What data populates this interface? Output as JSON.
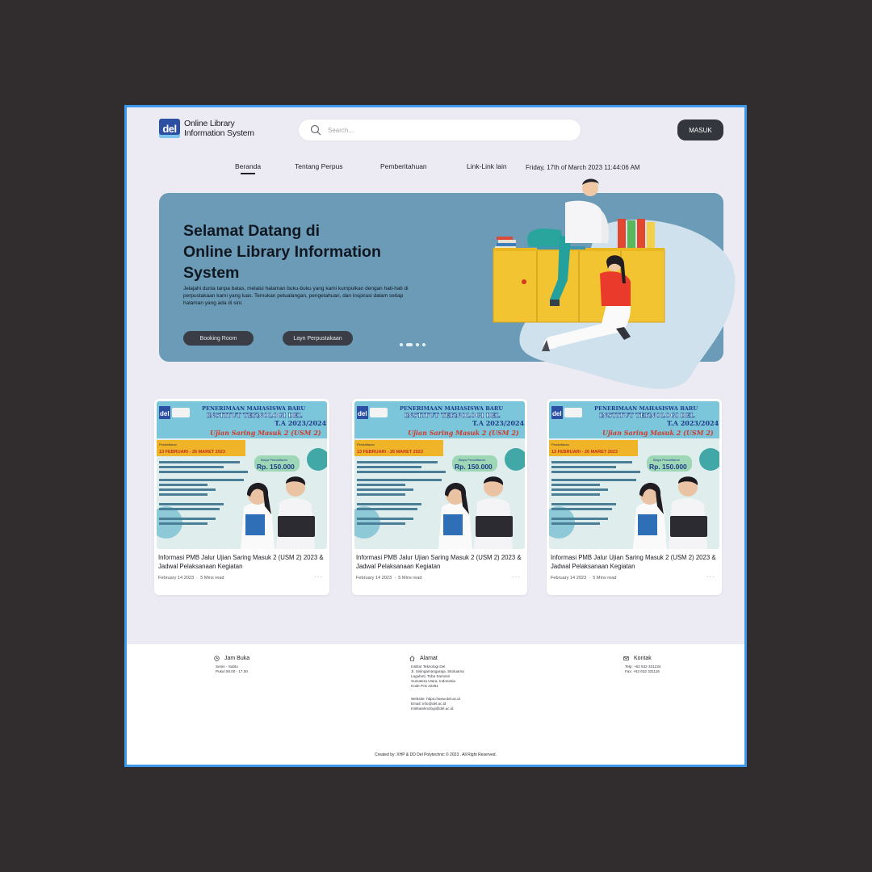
{
  "header": {
    "logo_badge": "del",
    "logo_line1": "Online Library",
    "logo_line2": "Information System",
    "search_placeholder": "Search...",
    "login_label": "MASUK"
  },
  "nav": {
    "items": [
      "Beranda",
      "Tentang Perpus",
      "Pemberitahuan",
      "Link-Link lain"
    ],
    "active": "Beranda",
    "datetime": "Friday, 17th of March 2023 11:44:06 AM"
  },
  "hero": {
    "title_line1": "Selamat Datang di",
    "title_line2": "Online Library Information",
    "title_line3": "System",
    "description": "Jelajahi dunia tanpa batas, melalui halaman buku-buku yang kami kumpulkan dengan hati-hati di perpustakaan kami yang luas. Temukan petualangan, pengetahuan, dan inspirasi dalam setiap halaman yang ada di sini.",
    "button1": "Booking Room",
    "button2": "Layn Perpustakaan"
  },
  "cards": [
    {
      "poster_header1": "PENERIMAAN MAHASISWA BARU",
      "poster_header2": "INSTITUT TEKNOLOGI DEL",
      "poster_year": "T.A 2023/2024",
      "poster_exam": "Ujian Saring Masuk 2 (USM 2)",
      "poster_dates_label": "Pendaftaran",
      "poster_dates": "13 FEBRUARI - 26 MARET 2023",
      "poster_fee_label": "Biaya Pendaftaran",
      "poster_fee": "Rp. 150.000",
      "title": "Informasi PMB Jalur Ujian Saring Masuk 2 (USM 2) 2023 & Jadwal Pelaksanaan Kegiatan",
      "date": "February 14 2023",
      "read": "5 Mins read"
    },
    {
      "poster_header1": "PENERIMAAN MAHASISWA BARU",
      "poster_header2": "INSTITUT TEKNOLOGI DEL",
      "poster_year": "T.A 2023/2024",
      "poster_exam": "Ujian Saring Masuk 2 (USM 2)",
      "poster_dates_label": "Pendaftaran",
      "poster_dates": "13 FEBRUARI - 26 MARET 2023",
      "poster_fee_label": "Biaya Pendaftaran",
      "poster_fee": "Rp. 150.000",
      "title": "Informasi PMB Jalur Ujian Saring Masuk 2 (USM 2) 2023 & Jadwal Pelaksanaan Kegiatan",
      "date": "February 14 2023",
      "read": "5 Mins read"
    },
    {
      "poster_header1": "PENERIMAAN MAHASISWA BARU",
      "poster_header2": "INSTITUT TEKNOLOGI DEL",
      "poster_year": "T.A 2023/2024",
      "poster_exam": "Ujian Saring Masuk 2 (USM 2)",
      "poster_dates_label": "Pendaftaran",
      "poster_dates": "13 FEBRUARI - 26 MARET 2023",
      "poster_fee_label": "Biaya Pendaftaran",
      "poster_fee": "Rp. 150.000",
      "title": "Informasi PMB Jalur Ujian Saring Masuk 2 (USM 2) 2023 & Jadwal Pelaksanaan Kegiatan",
      "date": "February 14 2023",
      "read": "5 Mins read"
    }
  ],
  "footer": {
    "hours_title": "Jam Buka",
    "hours_line1": "Senin - Sabtu",
    "hours_line2": "Pukul 08.00 - 17.00",
    "address_title": "Alamat",
    "address_line1": "Institut Teknologi Del",
    "address_line2": "Jl. Sisingamangaraja, Sitoluama",
    "address_line3": "Laguboti, Toba Samosir",
    "address_line4": "Sumatera Utara, Indonesia",
    "address_line5": "Kode Pos 22381",
    "address_line6": "Website: https://www.del.ac.id",
    "address_line7": "Email: info@del.ac.id",
    "address_line8": "Instituteknologi@del.ac.id",
    "contact_title": "Kontak",
    "contact_line1": "Telp: +62 632 331234",
    "contact_line2": "Fax: +62 632 331116",
    "copyright": "Created by: XHP & DD Del Polytechnic © 2023 . All Right Reserved."
  },
  "colors": {
    "page_bg": "#312c2d",
    "frame_border": "#3d98ea",
    "hero_bg": "#6b9bb7",
    "button_dark": "#34363d"
  }
}
